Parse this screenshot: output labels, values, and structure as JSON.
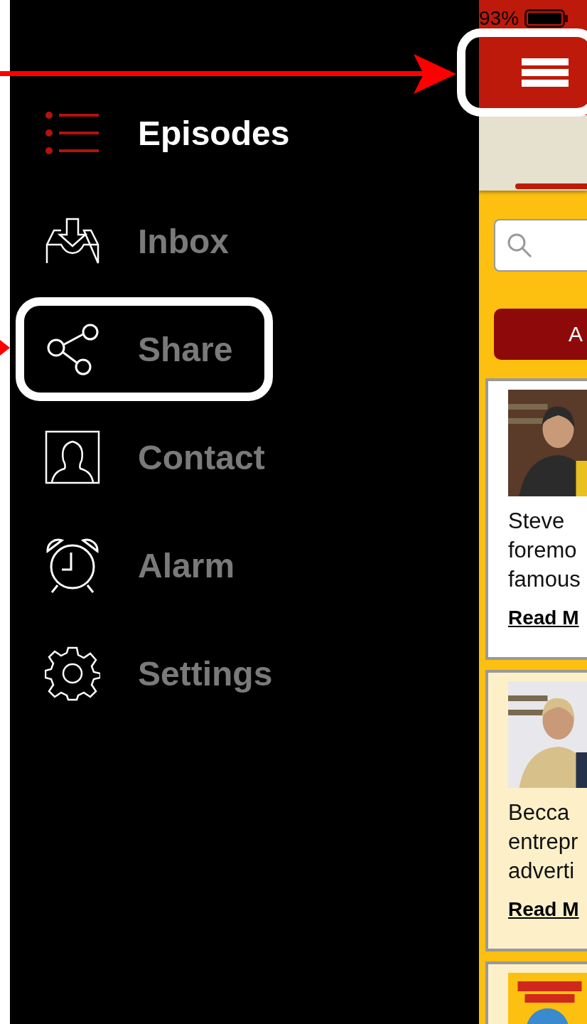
{
  "status_bar": {
    "battery": "93%"
  },
  "drawer": {
    "items": [
      {
        "label": "Episodes",
        "selected": true
      },
      {
        "label": "Inbox",
        "selected": false
      },
      {
        "label": "Share",
        "selected": false
      },
      {
        "label": "Contact",
        "selected": false
      },
      {
        "label": "Alarm",
        "selected": false
      },
      {
        "label": "Settings",
        "selected": false
      }
    ]
  },
  "filter_button": {
    "label": "A"
  },
  "cards": [
    {
      "color": "#ffffff",
      "text_lines": [
        "Steve",
        "foremo",
        "famous"
      ],
      "link": "Read M"
    },
    {
      "color": "#fdf0c8",
      "text_lines": [
        "Becca",
        "entrepr",
        "adverti"
      ],
      "link": "Read M"
    },
    {
      "color": "#fdf0c8"
    }
  ]
}
